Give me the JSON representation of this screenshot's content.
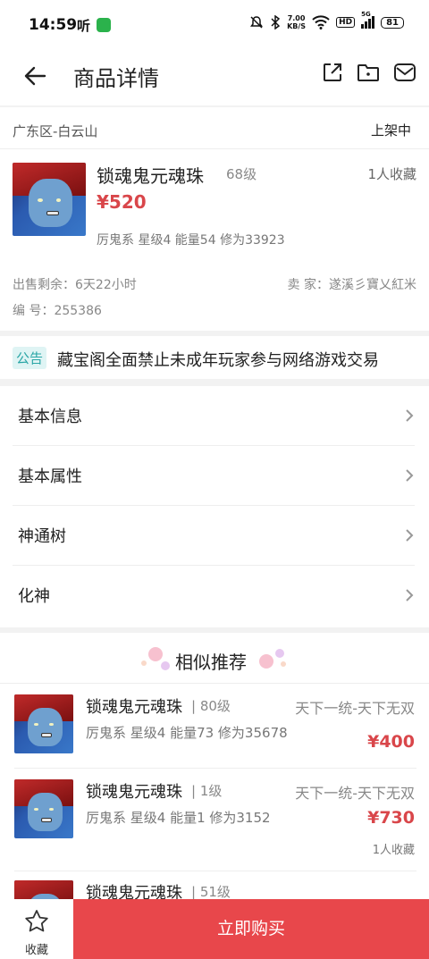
{
  "status_bar": {
    "time": "14:59",
    "app_icon_text": "听",
    "speed": "7.00",
    "speed_unit": "KB/S",
    "hd": "HD",
    "network": "5G",
    "battery": "81"
  },
  "nav": {
    "title": "商品详情"
  },
  "product": {
    "region": "广东区-白云山",
    "status": "上架中",
    "name": "锁魂鬼元魂珠",
    "level": "68级",
    "favorites": "1人收藏",
    "price": "¥520",
    "attributes": "厉鬼系 星级4 能量54 修为33923",
    "time_left": "出售剩余：6天22小时",
    "seller": "卖  家：遂溪彡寶乂紅米",
    "number": "编  号：255386"
  },
  "notice": {
    "tag": "公告",
    "text": "藏宝阁全面禁止未成年玩家参与网络游戏交易"
  },
  "menu": [
    {
      "label": "基本信息"
    },
    {
      "label": "基本属性"
    },
    {
      "label": "神通树"
    },
    {
      "label": "化神"
    }
  ],
  "recommend": {
    "title": "相似推荐",
    "items": [
      {
        "name": "锁魂鬼元魂珠",
        "level": "80级",
        "server": "天下一统-天下无双",
        "attributes": "厉鬼系 星级4 能量73 修为35678",
        "price": "¥400",
        "favorites": ""
      },
      {
        "name": "锁魂鬼元魂珠",
        "level": "1级",
        "server": "天下一统-天下无双",
        "attributes": "厉鬼系 星级4 能量1 修为3152",
        "price": "¥730",
        "favorites": "1人收藏"
      },
      {
        "name": "锁魂鬼元魂珠",
        "level": "51级",
        "server": "",
        "attributes": "",
        "price": "",
        "favorites": ""
      }
    ]
  },
  "bottom": {
    "favorite_label": "收藏",
    "buy_label": "立即购买"
  },
  "colors": {
    "accent": "#e8474b",
    "price": "#d9464a",
    "notice_tag": "#2aa6a6"
  }
}
